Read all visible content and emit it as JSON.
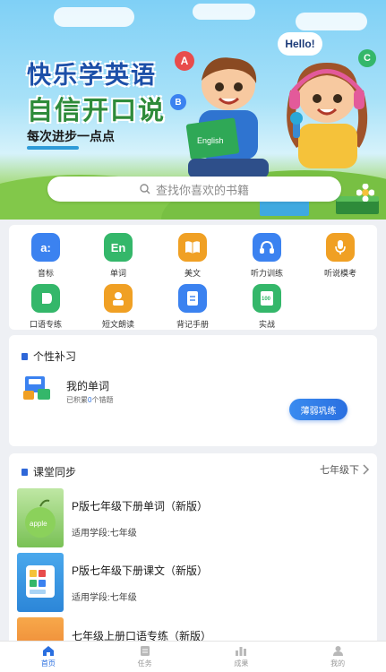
{
  "banner": {
    "title_line1": "快乐学英语",
    "title_line2": "自信开口说",
    "tagline": "每次进步一点点",
    "bubble_hello": "Hello!",
    "letters": [
      "A",
      "B",
      "C"
    ],
    "book_text": "English"
  },
  "search": {
    "placeholder": "查找你喜欢的书籍"
  },
  "features": [
    {
      "label": "音标",
      "glyph": "a:",
      "color": "#3b82f0",
      "icon": "phonetic-icon"
    },
    {
      "label": "单词",
      "glyph": "En",
      "color": "#34b76a",
      "icon": "word-icon"
    },
    {
      "label": "美文",
      "glyph": "📖",
      "color": "#f0a024",
      "icon": "book-icon"
    },
    {
      "label": "听力训练",
      "glyph": "🎧",
      "color": "#3b82f0",
      "icon": "headphones-icon"
    },
    {
      "label": "听说模考",
      "glyph": "🎤",
      "color": "#f0a024",
      "icon": "microphone-icon"
    },
    {
      "label": "口语专练",
      "glyph": "◖",
      "color": "#34b76a",
      "icon": "speech-icon"
    },
    {
      "label": "短文朗读",
      "glyph": "👤",
      "color": "#f0a024",
      "icon": "reader-icon"
    },
    {
      "label": "背记手册",
      "glyph": "☰",
      "color": "#3b82f0",
      "icon": "notebook-icon"
    },
    {
      "label": "实战",
      "glyph": "100",
      "color": "#34b76a",
      "icon": "exam-icon"
    }
  ],
  "personal": {
    "section_title": "个性补习",
    "item_title": "我的单词",
    "item_sub_prefix": "已积累",
    "item_count": "0",
    "item_sub_suffix": "个错题",
    "button_label": "薄弱巩练"
  },
  "classroom": {
    "section_title": "课堂同步",
    "grade_selector": "七年级下",
    "courses": [
      {
        "name": "P版七年级下册单词（新版）",
        "sub": "适用学段:七年级",
        "thumb_text": "apple"
      },
      {
        "name": "P版七年级下册课文（新版）",
        "sub": "适用学段:七年级",
        "thumb_text": ""
      },
      {
        "name": "七年级上册口语专练（新版）",
        "sub": "",
        "thumb_text": ""
      }
    ]
  },
  "tabbar": {
    "tabs": [
      {
        "label": "首页",
        "icon": "home-icon"
      },
      {
        "label": "任务",
        "icon": "task-icon"
      },
      {
        "label": "成果",
        "icon": "chart-icon"
      },
      {
        "label": "我的",
        "icon": "profile-icon"
      }
    ]
  },
  "colors": {
    "accent": "#2a6fe0",
    "green": "#34b76a",
    "orange": "#f0a024"
  }
}
